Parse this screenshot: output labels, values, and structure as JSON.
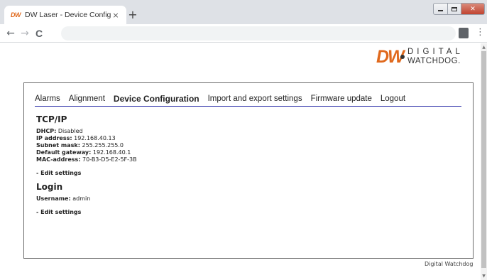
{
  "browser": {
    "tab_title": "DW Laser - Device Configuration",
    "tab_favicon": "DW",
    "tab_close": "×",
    "new_tab": "+",
    "back": "←",
    "forward": "→",
    "reload": "C",
    "menu": "⋮"
  },
  "logo": {
    "mark": "DW",
    "line1": "DIGITAL",
    "line2": "WATCHDOG."
  },
  "menu": {
    "items": [
      {
        "label": "Alarms"
      },
      {
        "label": "Alignment"
      },
      {
        "label": "Device Configuration"
      },
      {
        "label": "Import and export settings"
      },
      {
        "label": "Firmware update"
      },
      {
        "label": "Logout"
      }
    ],
    "active_index": 2
  },
  "tcpip": {
    "title": "TCP/IP",
    "fields": [
      {
        "label": "DHCP:",
        "value": "Disabled"
      },
      {
        "label": "IP address:",
        "value": "192.168.40.13"
      },
      {
        "label": "Subnet mask:",
        "value": "255.255.255.0"
      },
      {
        "label": "Default gateway:",
        "value": "192.168.40.1"
      },
      {
        "label": "MAC-address:",
        "value": "70-B3-D5-E2-5F-3B"
      }
    ],
    "edit_label": "- Edit settings"
  },
  "login": {
    "title": "Login",
    "fields": [
      {
        "label": "Username:",
        "value": "admin"
      }
    ],
    "edit_label": "- Edit settings"
  },
  "footer": {
    "text": "Digital Watchdog"
  },
  "colors": {
    "brand_orange": "#e0691d",
    "menu_underline": "#2b2ea8"
  }
}
